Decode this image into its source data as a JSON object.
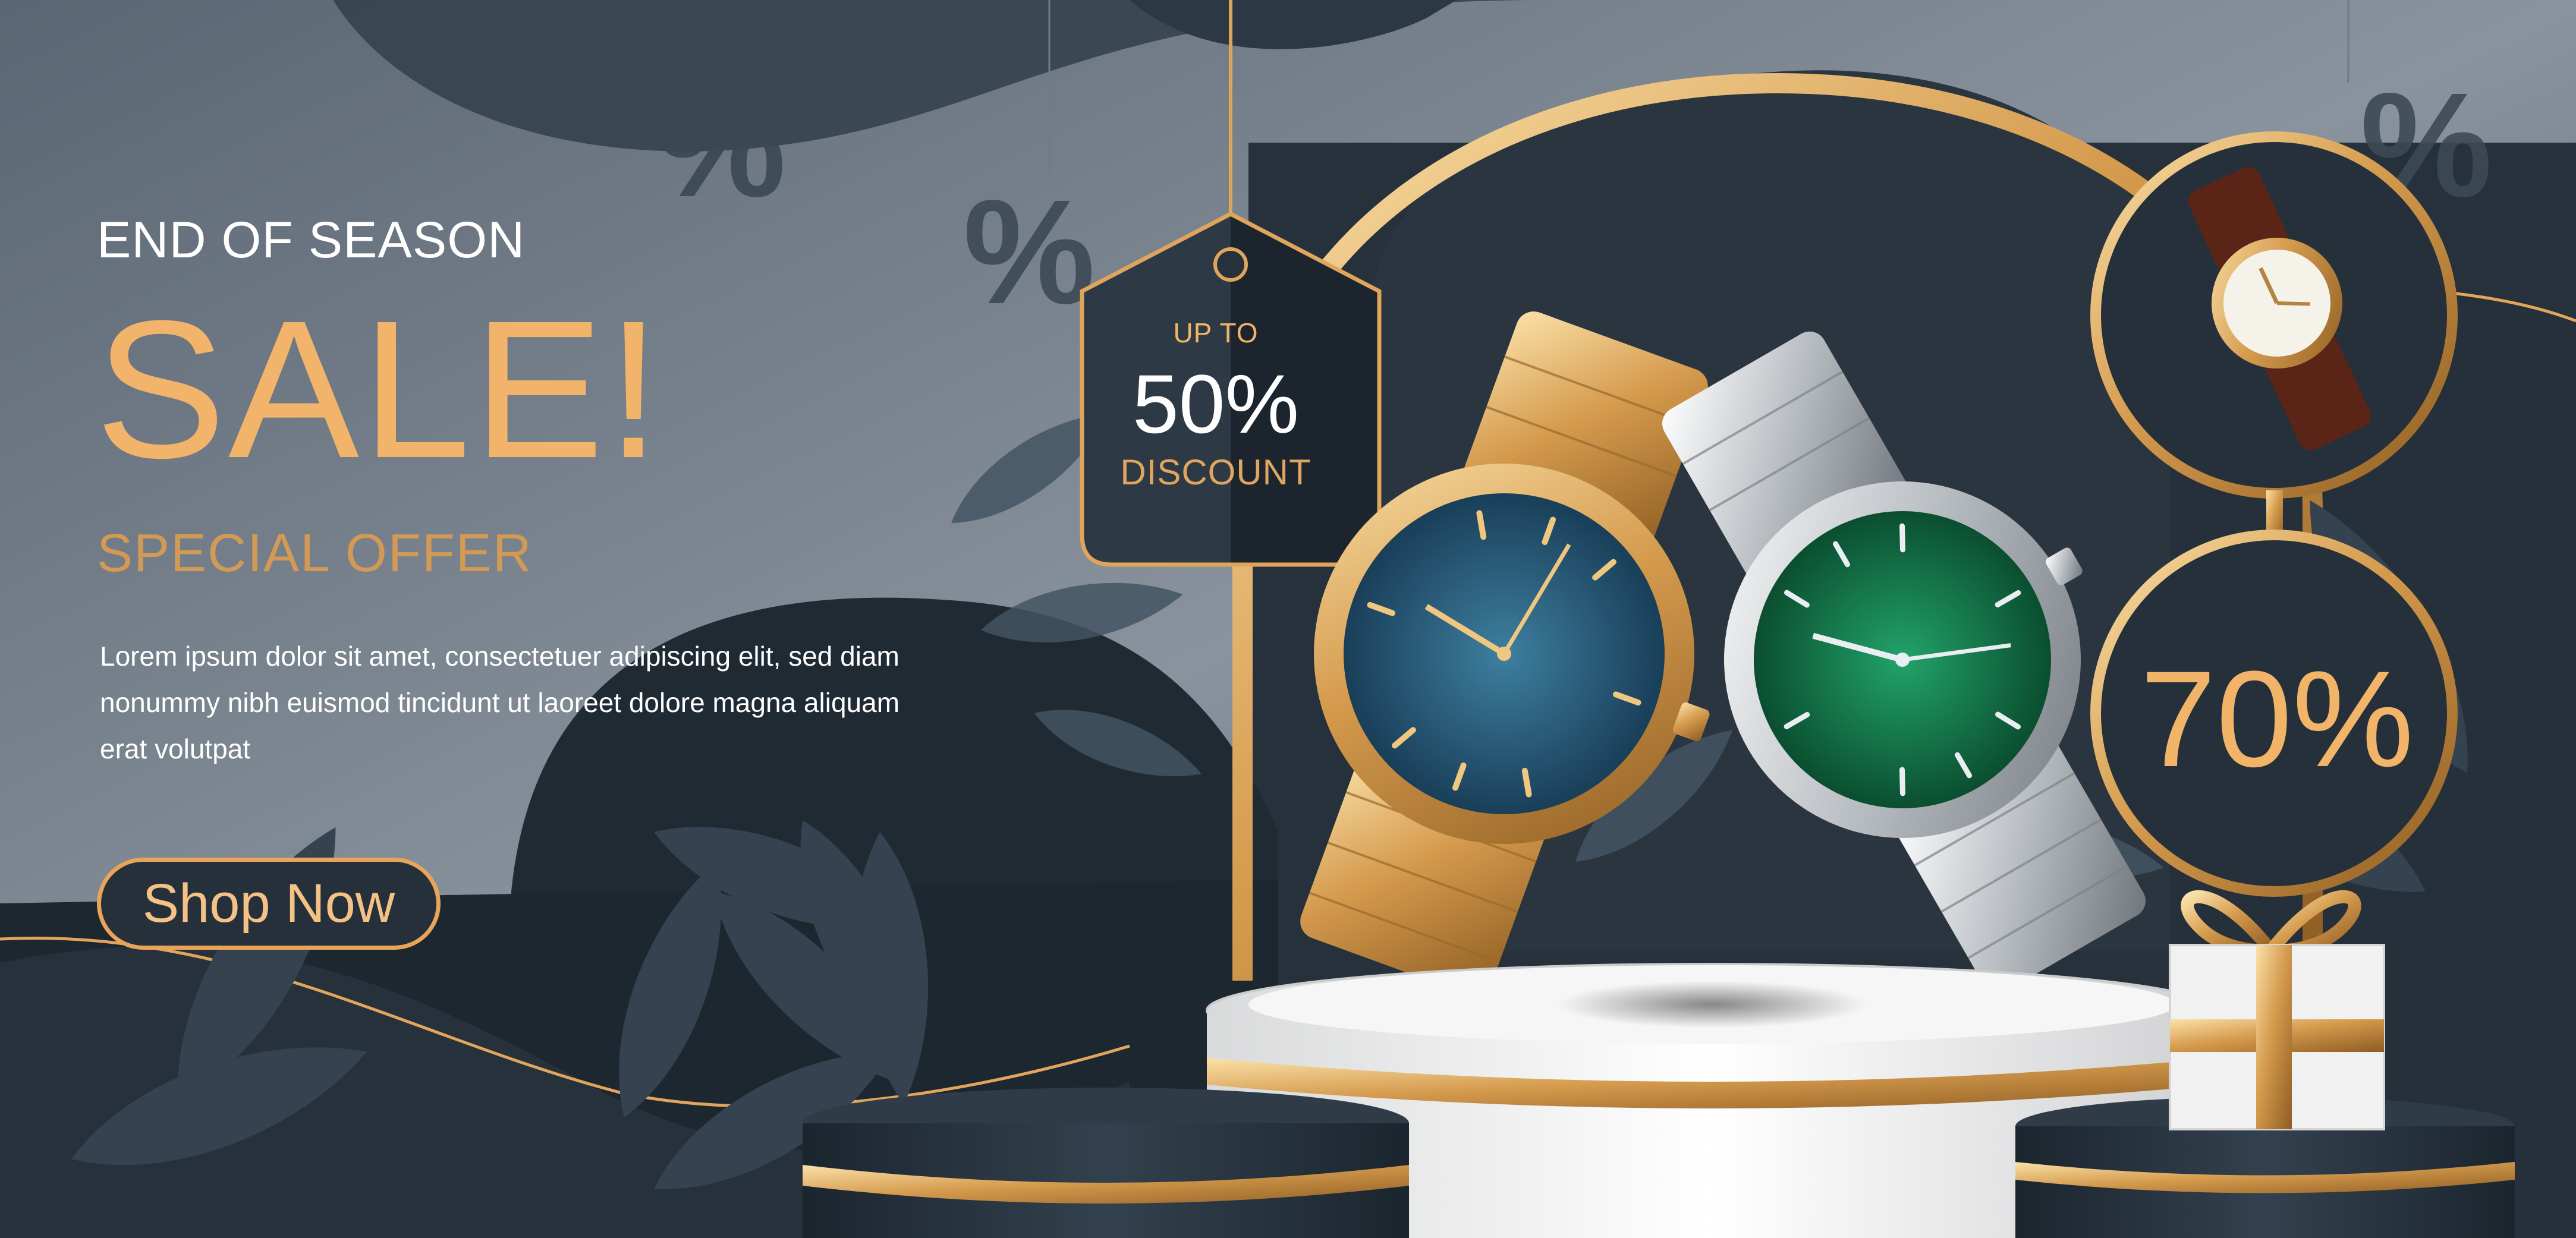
{
  "banner": {
    "kicker": "END OF SEASON",
    "headline": "SALE!",
    "subheadline": "SPECIAL OFFER",
    "body_lines": [
      "Lorem ipsum dolor sit amet, consectetuer adipiscing elit, sed diam",
      "nonummy nibh euismod tincidunt ut laoreet dolore magna aliquam",
      "erat volutpat"
    ],
    "cta_label": "Shop Now"
  },
  "price_tag": {
    "line1": "UP TO",
    "percent": "50%",
    "line3": "DISCOUNT"
  },
  "circle_badge": {
    "percent": "70%"
  },
  "decorations": {
    "percent_symbol": "%",
    "icons": [
      "gold-watch-icon",
      "silver-watch-icon",
      "leather-watch-icon",
      "gift-box-icon",
      "leaf-icon"
    ]
  },
  "colors": {
    "background_dark": "#1e2831",
    "background_mid": "#3b4753",
    "gold": "#e6a95f",
    "gold_light": "#f5c98a",
    "white_podium": "#f1f1f1",
    "teal_dial": "#1f4e6b",
    "green_dial": "#0f7a4e"
  }
}
